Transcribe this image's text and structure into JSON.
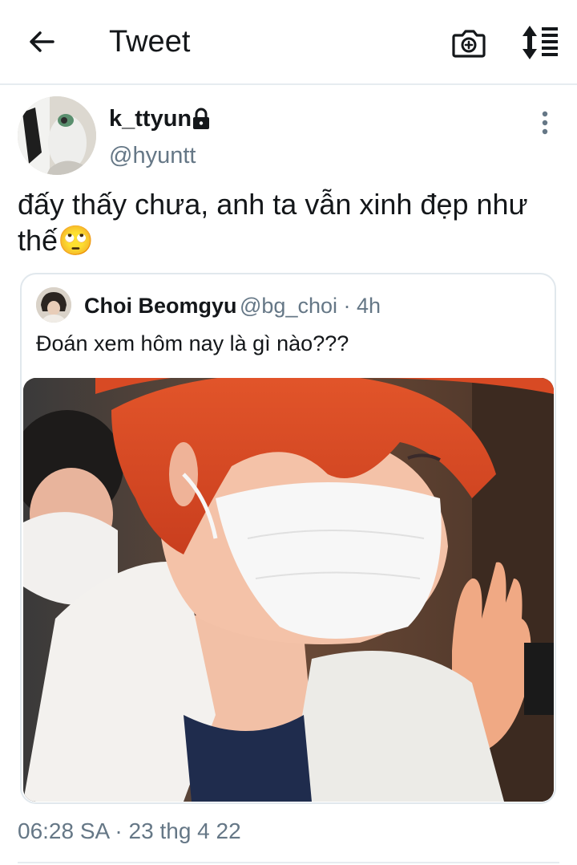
{
  "header": {
    "title": "Tweet",
    "back_icon": "arrow-left-icon",
    "camera_icon": "camera-plus-icon",
    "sort_icon": "sort-lines-icon"
  },
  "tweet": {
    "display_name": "k_ttyun",
    "handle": "@hyuntt",
    "text": "đấy thấy chưa, anh ta vẫn xinh đẹp như thế🙄",
    "timestamp": "06:28 SA · 23 thg 4 22",
    "protected_icon": "lock-icon",
    "more_icon": "more-vertical-icon"
  },
  "quoted_tweet": {
    "display_name": "Choi Beomgyu",
    "meta": "@bg_choi · 4h",
    "text": "Đoán xem hôm nay là gì nào???"
  },
  "colors": {
    "text_primary": "#14171a",
    "text_secondary": "#657786",
    "border": "#e1e8ed"
  }
}
